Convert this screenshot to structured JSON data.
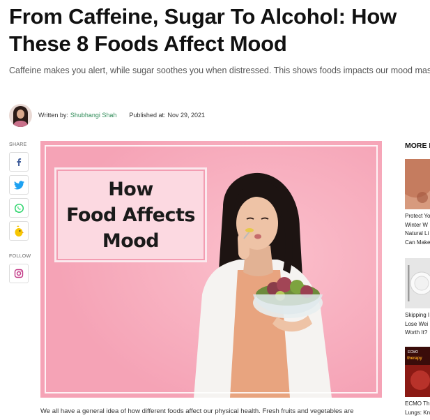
{
  "article": {
    "headline_line1": "From Caffeine, Sugar To Alcohol: How",
    "headline_line2": "These 8 Foods Affect Mood",
    "subhead": "Caffeine makes you alert, while sugar soothes you when distressed. This shows foods impacts our mood massively",
    "byline": {
      "written_by_label": "Written by:",
      "author": "Shubhangi Shah",
      "published_label": "Published at:",
      "published_date": "Nov 29, 2021"
    },
    "hero_card": {
      "line1": "How",
      "line2": "Food Affects",
      "line3": "Mood"
    },
    "body_first_line": "We all have a general idea of how different foods affect our physical health. Fresh fruits and vegetables are"
  },
  "share": {
    "label": "SHARE",
    "buttons": [
      {
        "name": "facebook-icon",
        "color": "#3b5998"
      },
      {
        "name": "twitter-icon",
        "color": "#1da1f2"
      },
      {
        "name": "whatsapp-icon",
        "color": "#25d366"
      },
      {
        "name": "koo-icon",
        "color": "#f7c600"
      }
    ]
  },
  "follow": {
    "label": "FOLLOW",
    "buttons": [
      {
        "name": "instagram-icon",
        "color": "#c13584"
      }
    ]
  },
  "sidebar": {
    "title": "MORE I",
    "items": [
      {
        "lines": [
          "Protect Yo",
          "Winter W",
          "Natural Li",
          "Can Make"
        ]
      },
      {
        "lines": [
          "Skipping I",
          "Lose Wei",
          "Worth It?"
        ]
      },
      {
        "lines": [
          "ECMO Th",
          "Lungs: Kn"
        ],
        "thumb_text_1": "ECMO",
        "thumb_text_2": "therapy"
      }
    ]
  },
  "colors": {
    "accent_green": "#2e8b57",
    "hero_pink": "#f7a9bb"
  }
}
